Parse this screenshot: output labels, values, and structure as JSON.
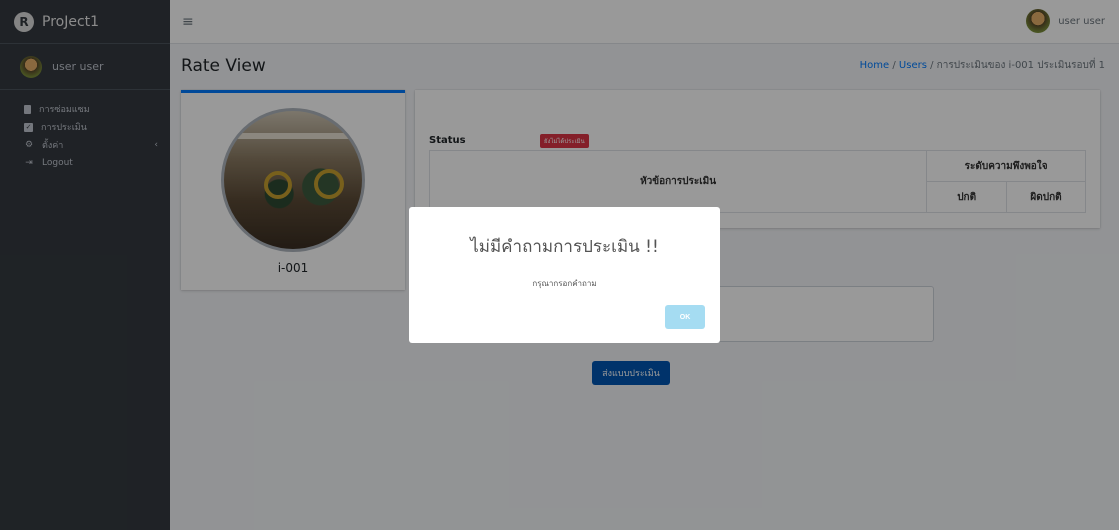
{
  "brand": {
    "logo_letter": "R",
    "name": "ProJect1"
  },
  "sidebar": {
    "user_name": "user user",
    "items": [
      {
        "icon": "document-icon",
        "label": "การซ่อมแซม"
      },
      {
        "icon": "check-square-icon",
        "label": "การประเมิน"
      },
      {
        "icon": "gear-icon",
        "label": "ตั้งค่า",
        "chevron": "‹"
      },
      {
        "icon": "logout-icon",
        "label": "Logout"
      }
    ]
  },
  "topbar": {
    "menu_glyph": "≡",
    "user_name": "user user"
  },
  "page": {
    "title": "Rate View",
    "breadcrumb": {
      "home": "Home",
      "sep1": " / ",
      "users": "Users",
      "sep2": " / ",
      "current": "การประเมินของ i-001 ประเมินรอบที่ 1"
    }
  },
  "machine_card": {
    "label": "i-001"
  },
  "status": {
    "label": "Status",
    "badge": "ยังไม่ได้ประเมิน",
    "badge_color": "#dc3545"
  },
  "table": {
    "topic_header": "หัวข้อการประเมิน",
    "satisfaction_header": "ระดับความพึงพอใจ",
    "normal": "ปกติ",
    "abnormal": "ผิดปกติ"
  },
  "form": {
    "submit_label": "ส่งแบบประเมิน"
  },
  "modal": {
    "title": "ไม่มีคำถามการประเมิน !!",
    "text": "กรุณากรอกคำถาม",
    "ok_label": "OK"
  }
}
